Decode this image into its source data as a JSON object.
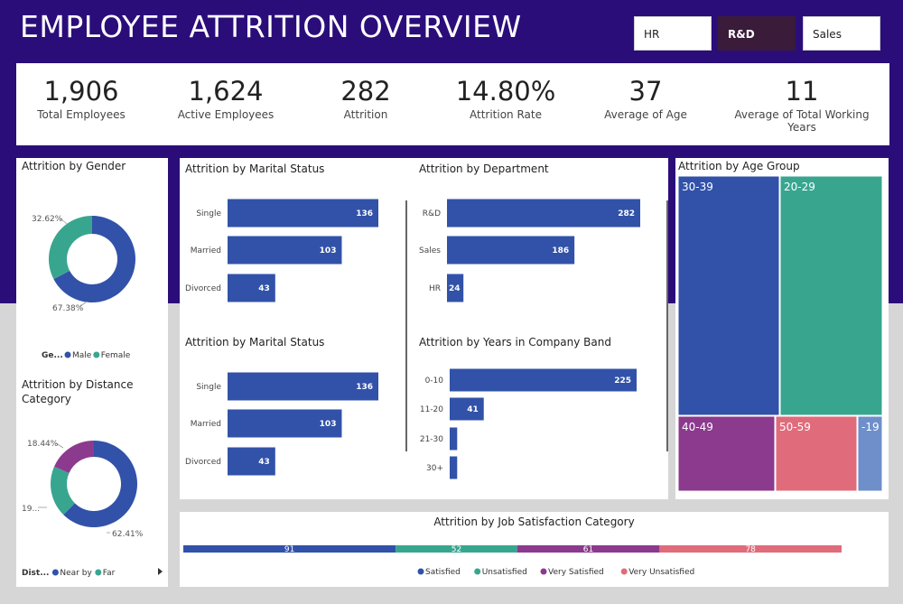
{
  "header": {
    "title": "EMPLOYEE ATTRITION OVERVIEW"
  },
  "slicers": [
    {
      "label": "HR",
      "selected": false
    },
    {
      "label": "R&D",
      "selected": true
    },
    {
      "label": "Sales",
      "selected": false
    }
  ],
  "kpis": [
    {
      "value": "1,906",
      "label": "Total Employees"
    },
    {
      "value": "1,624",
      "label": "Active Employees"
    },
    {
      "value": "282",
      "label": "Attrition"
    },
    {
      "value": "14.80%",
      "label": "Attrition Rate"
    },
    {
      "value": "37",
      "label": "Average of Age"
    },
    {
      "value": "11",
      "label": "Average of Total Working Years"
    }
  ],
  "colors": {
    "blue": "#3152a8",
    "teal": "#38a68f",
    "purple": "#8b3a8e",
    "pink": "#e06c7b",
    "lightblue": "#6f8fcb",
    "header": "#2b0d7a"
  },
  "chart_data": [
    {
      "type": "pie",
      "title": "Attrition by Gender",
      "legend_title": "Ge...",
      "categories": [
        "Male",
        "Female"
      ],
      "values": [
        67.38,
        32.62
      ],
      "labels": [
        "67.38%",
        "32.62%"
      ],
      "colors": [
        "#3152a8",
        "#38a68f"
      ],
      "legend_placement": "bottom"
    },
    {
      "type": "pie",
      "title": "Attrition by Distance Category",
      "legend_title": "Dist...",
      "categories": [
        "Near by",
        "Far"
      ],
      "values": [
        62.41,
        19.15,
        18.44
      ],
      "labels": [
        "62.41%",
        "19...",
        "18.44%"
      ],
      "colors": [
        "#3152a8",
        "#38a68f",
        "#8b3a8e"
      ],
      "legend_placement": "bottom"
    },
    {
      "type": "bar",
      "title": "Attrition by Marital Status",
      "categories": [
        "Single",
        "Married",
        "Divorced"
      ],
      "values": [
        136,
        103,
        43
      ],
      "color": "#3152a8"
    },
    {
      "type": "bar",
      "title": "Attrition by Department",
      "categories": [
        "R&D",
        "Sales",
        "HR"
      ],
      "values": [
        282,
        186,
        24
      ],
      "color": "#3152a8"
    },
    {
      "type": "bar",
      "title": "Attrition by Marital Status",
      "categories": [
        "Single",
        "Married",
        "Divorced"
      ],
      "values": [
        136,
        103,
        43
      ],
      "color": "#3152a8"
    },
    {
      "type": "bar",
      "title": "Attrition by Years in Company Band",
      "categories": [
        "0-10",
        "11-20",
        "21-30",
        "30+"
      ],
      "values": [
        225,
        41,
        9,
        9
      ],
      "labels": [
        "225",
        "41",
        "",
        ""
      ],
      "color": "#3152a8"
    },
    {
      "type": "heatmap",
      "title": "Attrition by Age Group",
      "categories": [
        "30-39",
        "20-29",
        "40-49",
        "50-59",
        "-19"
      ],
      "values": [
        93,
        90,
        35,
        30,
        8
      ],
      "colors": [
        "#3152a8",
        "#38a68f",
        "#8b3a8e",
        "#e06c7b",
        "#6f8fcb"
      ]
    },
    {
      "type": "bar",
      "title": "Attrition by Job Satisfaction Category",
      "categories": [
        "Satisfied",
        "Unsatisfied",
        "Very Satisfied",
        "Very Unsatisfied"
      ],
      "values": [
        91,
        52,
        61,
        78
      ],
      "colors": [
        "#3152a8",
        "#38a68f",
        "#8b3a8e",
        "#e06c7b"
      ],
      "legend_placement": "bottom"
    }
  ]
}
